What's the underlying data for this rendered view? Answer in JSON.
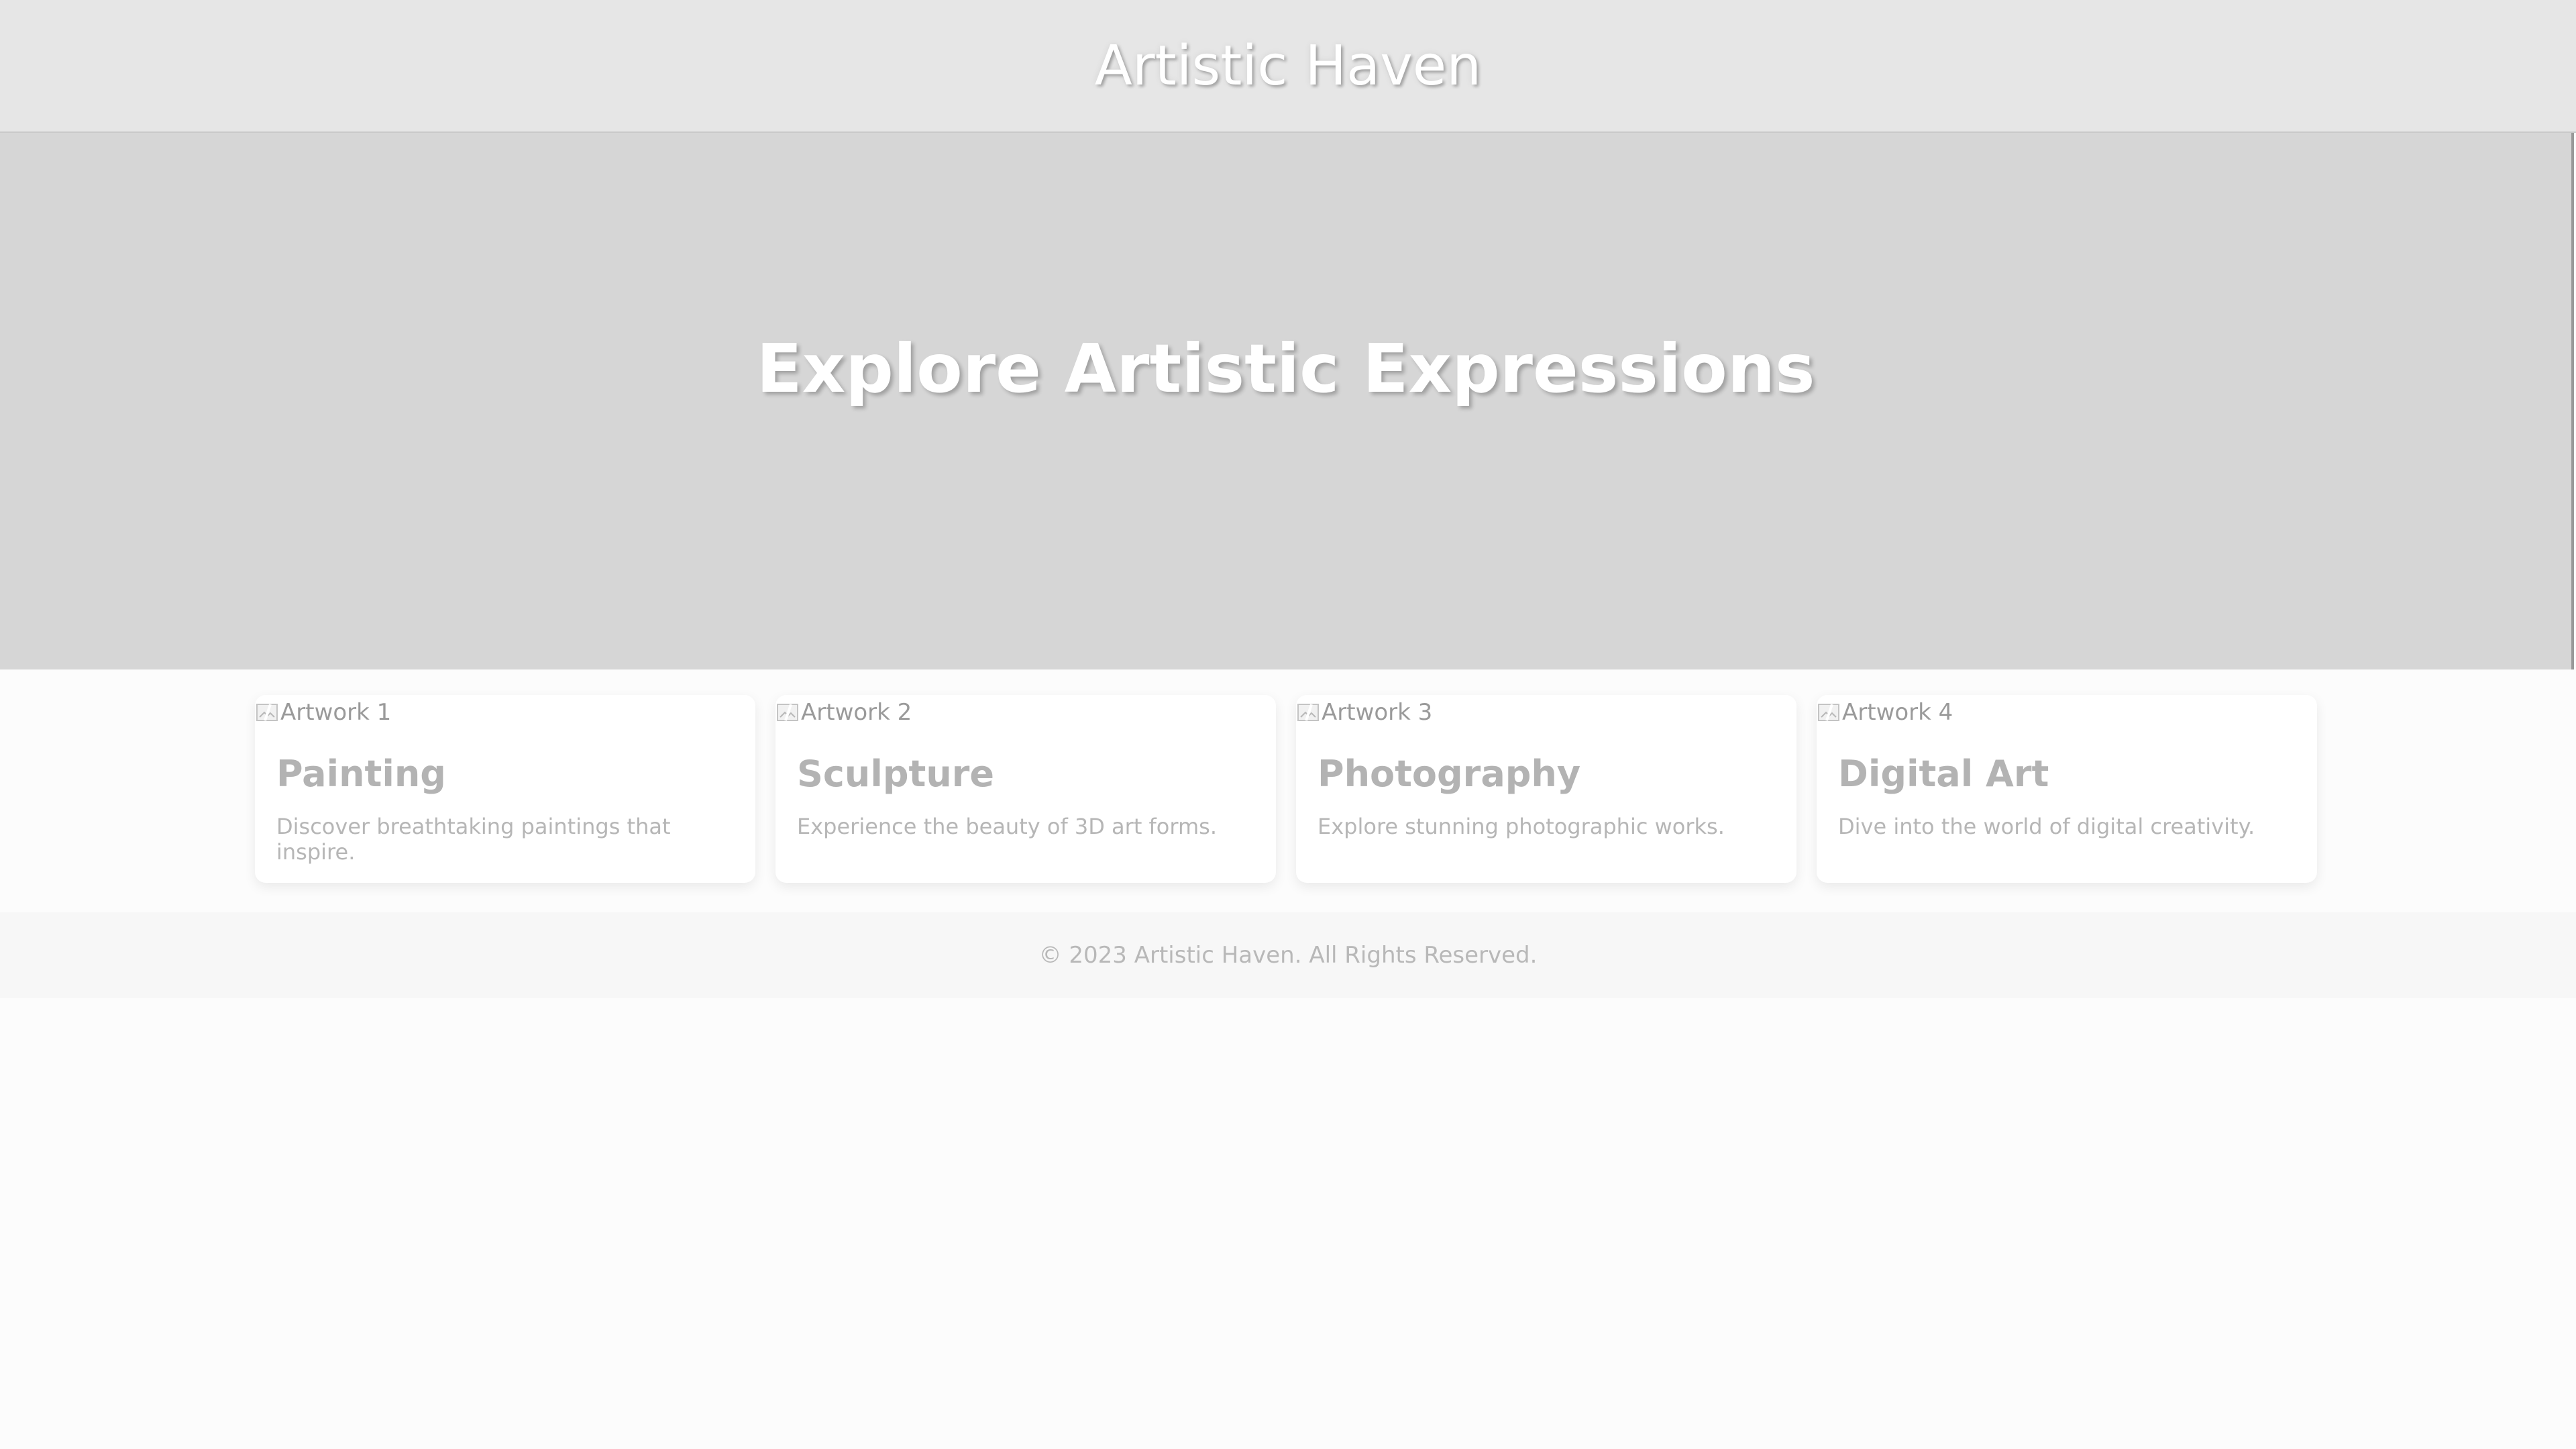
{
  "header": {
    "title": "Artistic Haven"
  },
  "hero": {
    "title": "Explore Artistic Expressions"
  },
  "cards": [
    {
      "image_alt": "Artwork 1",
      "title": "Painting",
      "description": "Discover breathtaking paintings that inspire."
    },
    {
      "image_alt": "Artwork 2",
      "title": "Sculpture",
      "description": "Experience the beauty of 3D art forms."
    },
    {
      "image_alt": "Artwork 3",
      "title": "Photography",
      "description": "Explore stunning photographic works."
    },
    {
      "image_alt": "Artwork 4",
      "title": "Digital Art",
      "description": "Dive into the world of digital creativity."
    }
  ],
  "footer": {
    "copyright": "© 2023 Artistic Haven. All Rights Reserved."
  }
}
